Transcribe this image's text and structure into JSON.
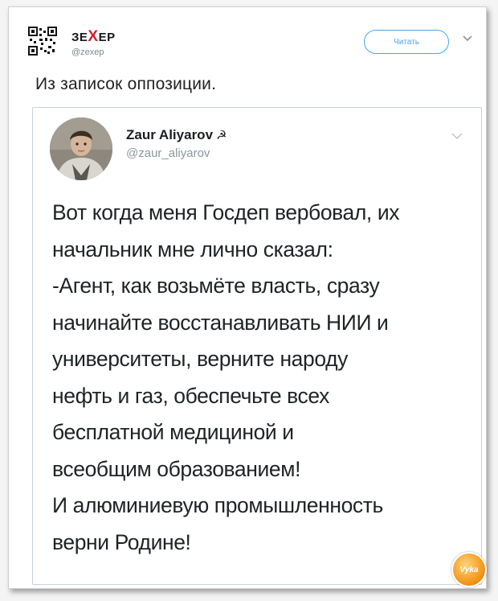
{
  "post": {
    "author_name_left": "ЗЕ",
    "author_name_mid": "Х",
    "author_name_right": "ЕР",
    "author_handle": "@zexep",
    "follow_label": "Читать",
    "text": "Из записок оппозиции."
  },
  "quoted": {
    "name": "Zaur Aliyarov",
    "name_symbol": "☭",
    "handle": "@zaur_aliyarov",
    "lines": [
      "Вот когда меня Госдеп вербовал, их",
      "начальник мне лично сказал:",
      "-Агент, как возьмёте власть, сразу",
      "начинайте восстанавливать НИИ и",
      "университеты, верните народу",
      "нефть и газ, обеспечьте всех",
      "бесплатной медициной и",
      "всеобщим образованием!",
      "И алюминиевую промышленность",
      "верни Родине!"
    ]
  },
  "watermark": {
    "label": "Vyka"
  },
  "colors": {
    "accent": "#4aa3f1",
    "brand_x": "#d21f2b"
  },
  "icons": {
    "qr": "qr-code-icon",
    "chevron": "chevron-down-icon",
    "symbol": "hammer-sickle-icon"
  }
}
